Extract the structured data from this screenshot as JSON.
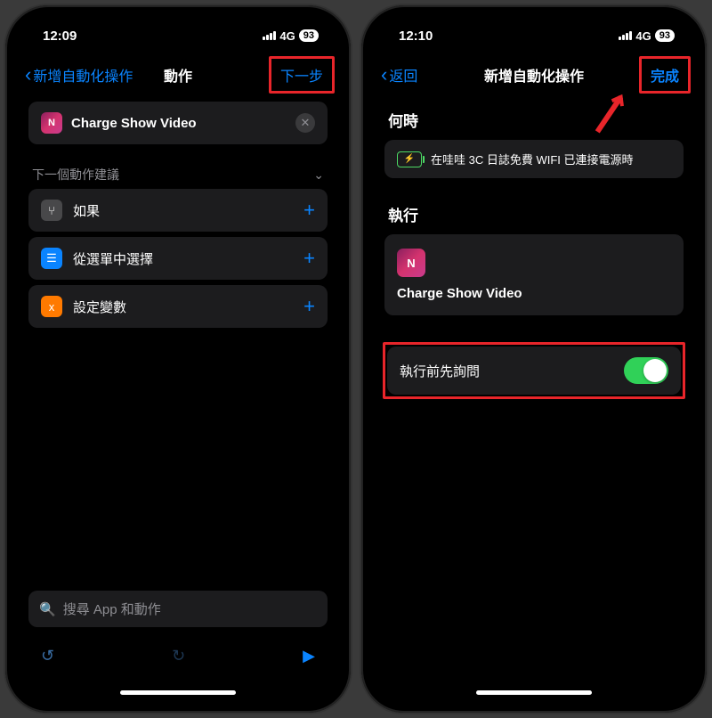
{
  "status": {
    "time_left": "12:09",
    "time_right": "12:10",
    "network": "4G",
    "battery": "93"
  },
  "left": {
    "nav": {
      "back": "新增自動化操作",
      "title": "動作",
      "next": "下一步"
    },
    "action": {
      "title": "Charge Show Video"
    },
    "suggestions_header": "下一個動作建議",
    "items": [
      {
        "icon": "branch",
        "label": "如果"
      },
      {
        "icon": "menu",
        "label": "從選單中選擇"
      },
      {
        "icon": "var",
        "label": "設定變數"
      }
    ],
    "search_placeholder": "搜尋 App 和動作"
  },
  "right": {
    "nav": {
      "back": "返回",
      "title": "新增自動化操作",
      "done": "完成"
    },
    "when_header": "何時",
    "when_text": "在哇哇 3C 日誌免費 WIFI 已連接電源時",
    "run_header": "執行",
    "action_name": "Charge Show Video",
    "ask_before_label": "執行前先詢問"
  }
}
